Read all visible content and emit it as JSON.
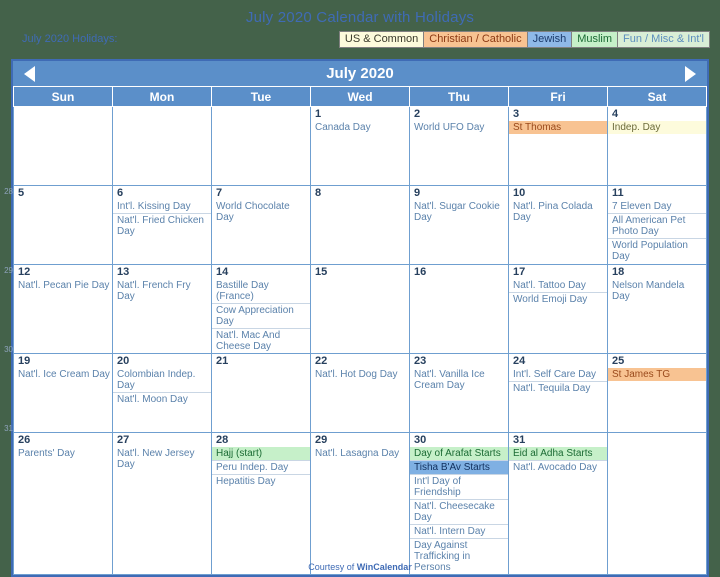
{
  "page": {
    "title": "July 2020 Calendar with Holidays",
    "holidays_label": "July 2020 Holidays:",
    "footer_prefix": "Courtesy of ",
    "footer_brand": "WinCalendar",
    "accent_blue": "#3f6bb5",
    "header_blue": "#5b8fc9",
    "background": "#44624a"
  },
  "legend": [
    {
      "label": "US & Common",
      "key": "us",
      "color": "#fdfbdc"
    },
    {
      "label": "Christian / Catholic",
      "key": "chr",
      "color": "#f8c392"
    },
    {
      "label": "Jewish",
      "key": "jew",
      "color": "#8fb9e8"
    },
    {
      "label": "Muslim",
      "key": "mus",
      "color": "#c6f0c9"
    },
    {
      "label": "Fun / Misc & Int'l",
      "key": "fun",
      "color": "#d9eed6"
    }
  ],
  "calendar": {
    "month_title": "July 2020",
    "prev_label": "Previous month",
    "next_label": "Next month",
    "weekday_headers": [
      "Sun",
      "Mon",
      "Tue",
      "Wed",
      "Thu",
      "Fri",
      "Sat"
    ],
    "week_numbers": [
      "",
      "28",
      "29",
      "30",
      "31"
    ],
    "weeks": [
      [
        {
          "blank": true
        },
        {
          "blank": true
        },
        {
          "blank": true
        },
        {
          "num": "1",
          "events": [
            {
              "text": "Canada Day",
              "cat": "fun"
            }
          ]
        },
        {
          "num": "2",
          "events": [
            {
              "text": "World UFO Day",
              "cat": "fun"
            }
          ]
        },
        {
          "num": "3",
          "events": [
            {
              "text": "St Thomas",
              "cat": "chr"
            }
          ]
        },
        {
          "num": "4",
          "weekend": true,
          "events": [
            {
              "text": "Indep. Day",
              "cat": "us"
            }
          ]
        }
      ],
      [
        {
          "num": "5",
          "weekend": true,
          "events": []
        },
        {
          "num": "6",
          "events": [
            {
              "text": "Int'l. Kissing Day",
              "cat": "fun"
            },
            {
              "text": "Nat'l. Fried Chicken Day",
              "cat": "fun"
            }
          ]
        },
        {
          "num": "7",
          "events": [
            {
              "text": "World Chocolate Day",
              "cat": "fun"
            }
          ]
        },
        {
          "num": "8",
          "events": []
        },
        {
          "num": "9",
          "events": [
            {
              "text": "Nat'l. Sugar Cookie Day",
              "cat": "fun"
            }
          ]
        },
        {
          "num": "10",
          "events": [
            {
              "text": "Nat'l. Pina Colada Day",
              "cat": "fun"
            }
          ]
        },
        {
          "num": "11",
          "weekend": true,
          "events": [
            {
              "text": "7 Eleven Day",
              "cat": "fun"
            },
            {
              "text": "All American Pet Photo Day",
              "cat": "fun"
            },
            {
              "text": "World Population Day",
              "cat": "fun"
            }
          ]
        }
      ],
      [
        {
          "num": "12",
          "weekend": true,
          "events": [
            {
              "text": "Nat'l. Pecan Pie Day",
              "cat": "fun"
            }
          ]
        },
        {
          "num": "13",
          "events": [
            {
              "text": "Nat'l. French Fry Day",
              "cat": "fun"
            }
          ]
        },
        {
          "num": "14",
          "events": [
            {
              "text": "Bastille Day (France)",
              "cat": "fun"
            },
            {
              "text": "Cow Appreciation Day",
              "cat": "fun"
            },
            {
              "text": "Nat'l. Mac And Cheese Day",
              "cat": "fun"
            }
          ]
        },
        {
          "num": "15",
          "events": []
        },
        {
          "num": "16",
          "events": []
        },
        {
          "num": "17",
          "events": [
            {
              "text": "Nat'l. Tattoo Day",
              "cat": "fun"
            },
            {
              "text": "World Emoji Day",
              "cat": "fun"
            }
          ]
        },
        {
          "num": "18",
          "weekend": true,
          "events": [
            {
              "text": "Nelson Mandela Day",
              "cat": "fun"
            }
          ]
        }
      ],
      [
        {
          "num": "19",
          "weekend": true,
          "events": [
            {
              "text": "Nat'l. Ice Cream Day",
              "cat": "fun"
            }
          ]
        },
        {
          "num": "20",
          "events": [
            {
              "text": "Colombian Indep. Day",
              "cat": "fun"
            },
            {
              "text": "Nat'l. Moon Day",
              "cat": "fun"
            }
          ]
        },
        {
          "num": "21",
          "events": []
        },
        {
          "num": "22",
          "events": [
            {
              "text": "Nat'l. Hot Dog Day",
              "cat": "fun"
            }
          ]
        },
        {
          "num": "23",
          "events": [
            {
              "text": "Nat'l. Vanilla Ice Cream Day",
              "cat": "fun"
            }
          ]
        },
        {
          "num": "24",
          "events": [
            {
              "text": "Int'l. Self Care Day",
              "cat": "fun"
            },
            {
              "text": "Nat'l. Tequila Day",
              "cat": "fun"
            }
          ]
        },
        {
          "num": "25",
          "weekend": true,
          "events": [
            {
              "text": "St James TG",
              "cat": "chr"
            }
          ]
        }
      ],
      [
        {
          "num": "26",
          "weekend": true,
          "events": [
            {
              "text": "Parents' Day",
              "cat": "fun"
            }
          ]
        },
        {
          "num": "27",
          "events": [
            {
              "text": "Nat'l. New Jersey Day",
              "cat": "fun"
            }
          ]
        },
        {
          "num": "28",
          "events": [
            {
              "text": "Hajj (start)",
              "cat": "mus"
            },
            {
              "text": "Peru Indep. Day",
              "cat": "fun"
            },
            {
              "text": "Hepatitis Day",
              "cat": "fun"
            }
          ]
        },
        {
          "num": "29",
          "events": [
            {
              "text": "Nat'l. Lasagna Day",
              "cat": "fun"
            }
          ]
        },
        {
          "num": "30",
          "events": [
            {
              "text": "Day of Arafat Starts",
              "cat": "mus"
            },
            {
              "text": "Tisha B'Av Starts",
              "cat": "jew"
            },
            {
              "text": "Int'l Day of Friendship",
              "cat": "fun"
            },
            {
              "text": "Nat'l. Cheesecake Day",
              "cat": "fun"
            },
            {
              "text": "Nat'l. Intern Day",
              "cat": "fun"
            },
            {
              "text": "Day Against Trafficking in Persons",
              "cat": "fun"
            }
          ]
        },
        {
          "num": "31",
          "events": [
            {
              "text": "Eid al Adha Starts",
              "cat": "mus"
            },
            {
              "text": "Nat'l. Avocado Day",
              "cat": "fun"
            }
          ]
        },
        {
          "blank": true
        }
      ]
    ]
  }
}
